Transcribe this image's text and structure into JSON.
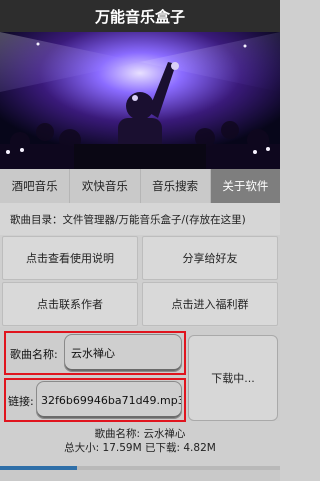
{
  "app": {
    "title": "万能音乐盒子"
  },
  "banner": {
    "image": "dj-concert-photo"
  },
  "tabs": [
    {
      "label": "酒吧音乐",
      "active": false
    },
    {
      "label": "欢快音乐",
      "active": false
    },
    {
      "label": "音乐搜索",
      "active": false
    },
    {
      "label": "关于软件",
      "active": true
    }
  ],
  "directory": {
    "text": "歌曲目录：文件管理器/万能音乐盒子/(存放在这里)"
  },
  "buttons": {
    "help": "点击查看使用说明",
    "share": "分享给好友",
    "contact": "点击联系作者",
    "group": "点击进入福利群"
  },
  "form": {
    "song_label": "歌曲名称:",
    "song_value": "云水禅心",
    "link_label": "链接:",
    "link_value": "32f6b69946ba71d49.mp3",
    "highlight_color": "#e0141e"
  },
  "download": {
    "label": "下载中..."
  },
  "status": {
    "line1": "歌曲名称: 云水禅心",
    "line2": "总大小: 17.59M   已下载: 4.82M",
    "progress_fraction": 0.274
  }
}
